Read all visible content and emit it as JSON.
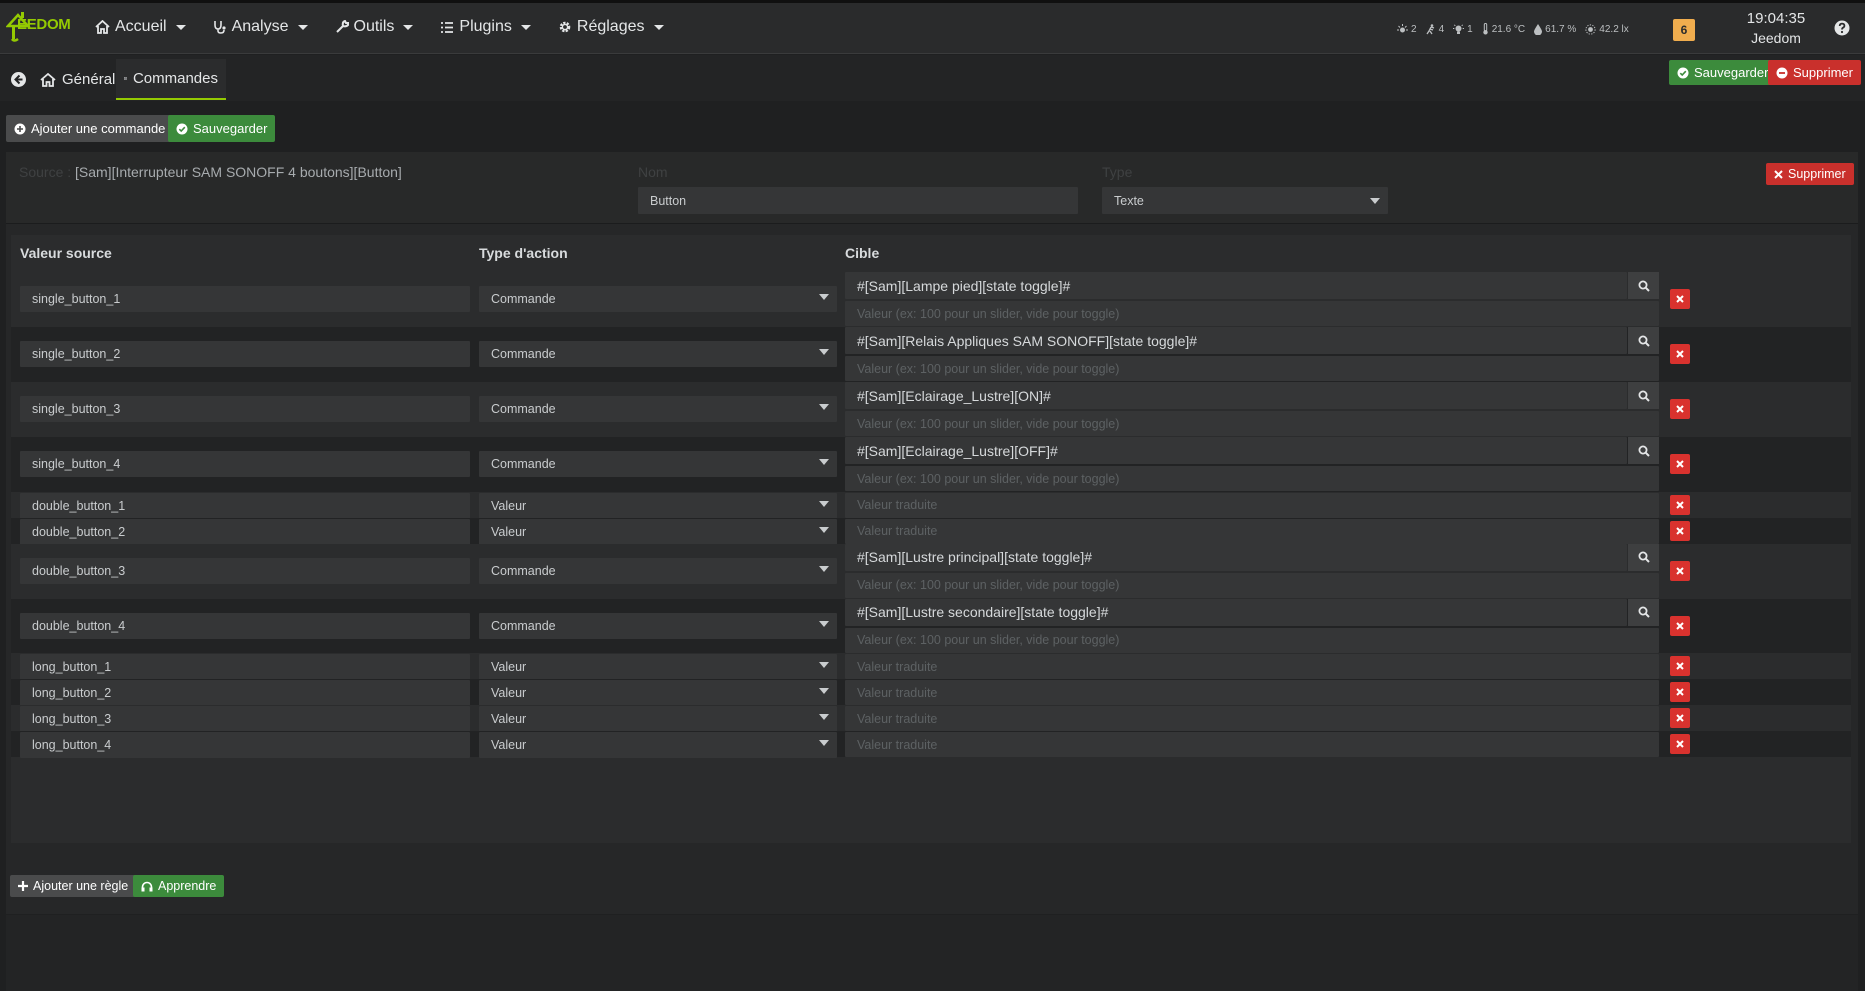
{
  "navbar": {
    "logo_text": "EEDOM",
    "menu": [
      {
        "label": "Accueil",
        "icon": "home-icon"
      },
      {
        "label": "Analyse",
        "icon": "stethoscope-icon"
      },
      {
        "label": "Outils",
        "icon": "wrench-icon"
      },
      {
        "label": "Plugins",
        "icon": "list-icon"
      },
      {
        "label": "Réglages",
        "icon": "gear-icon"
      }
    ],
    "sensors": {
      "lights": "2",
      "motion": "4",
      "bulbs": "1",
      "temperature": "21.6 °C",
      "humidity": "61.7 %",
      "luminosity": "42.2 lx"
    },
    "message_count": "6",
    "time": "19:04:35",
    "user": "Jeedom"
  },
  "tabs": {
    "general": "Général",
    "commandes": "Commandes"
  },
  "top_actions": {
    "save": "Sauvegarder",
    "delete": "Supprimer"
  },
  "toolbar": {
    "add_command": "Ajouter une commande",
    "save": "Sauvegarder"
  },
  "command": {
    "source_label": "Source :",
    "source_value": "[Sam][Interrupteur SAM SONOFF 4 boutons][Button]",
    "nom_label": "Nom",
    "nom_value": "Button",
    "type_label": "Type",
    "type_value": "Texte",
    "delete": "Supprimer"
  },
  "rules": {
    "headers": {
      "source": "Valeur source",
      "action": "Type d'action",
      "target": "Cible"
    },
    "value_placeholder": "Valeur (ex: 100 pour un slider, vide pour toggle)",
    "translated_placeholder": "Valeur traduite",
    "items": [
      {
        "source": "single_button_1",
        "action": "Commande",
        "target": "#[Sam][Lampe pied][state toggle]#"
      },
      {
        "source": "single_button_2",
        "action": "Commande",
        "target": "#[Sam][Relais Appliques SAM SONOFF][state toggle]#"
      },
      {
        "source": "single_button_3",
        "action": "Commande",
        "target": "#[Sam][Eclairage_Lustre][ON]#"
      },
      {
        "source": "single_button_4",
        "action": "Commande",
        "target": "#[Sam][Eclairage_Lustre][OFF]#"
      },
      {
        "source": "double_button_1",
        "action": "Valeur",
        "target": ""
      },
      {
        "source": "double_button_2",
        "action": "Valeur",
        "target": ""
      },
      {
        "source": "double_button_3",
        "action": "Commande",
        "target": "#[Sam][Lustre principal][state toggle]#"
      },
      {
        "source": "double_button_4",
        "action": "Commande",
        "target": "#[Sam][Lustre secondaire][state toggle]#"
      },
      {
        "source": "long_button_1",
        "action": "Valeur",
        "target": ""
      },
      {
        "source": "long_button_2",
        "action": "Valeur",
        "target": ""
      },
      {
        "source": "long_button_3",
        "action": "Valeur",
        "target": ""
      },
      {
        "source": "long_button_4",
        "action": "Valeur",
        "target": ""
      }
    ]
  },
  "bottom_actions": {
    "add_rule": "Ajouter une règle",
    "learn": "Apprendre"
  },
  "colors": {
    "accent": "#94ca02",
    "success": "#3c8b3c",
    "danger": "#c9302c",
    "warning": "#f0ad4e"
  }
}
